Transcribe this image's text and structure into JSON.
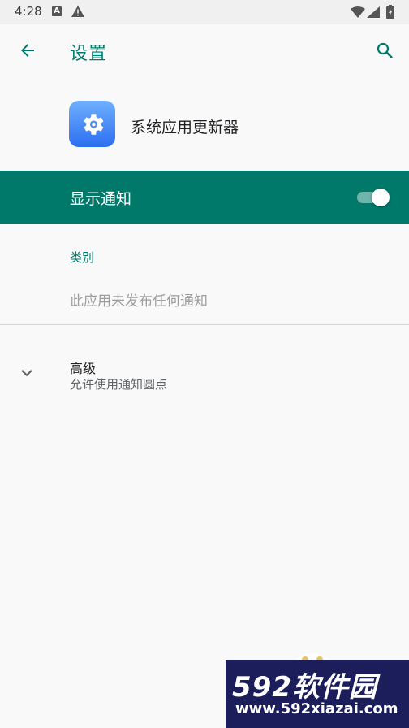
{
  "status_bar": {
    "time": "4:28"
  },
  "app_bar": {
    "title": "设置"
  },
  "app": {
    "name": "系统应用更新器"
  },
  "notifications": {
    "toggle_label": "显示通知",
    "enabled": true
  },
  "category": {
    "header": "类别",
    "empty_text": "此应用未发布任何通知"
  },
  "advanced": {
    "title": "高级",
    "summary": "允许使用通知圆点"
  },
  "watermark": {
    "brand": "592软件园",
    "url": "www.592xiazai.com"
  },
  "colors": {
    "accent": "#00796b",
    "background": "#f9f9f9"
  },
  "icons": [
    "back-arrow-icon",
    "search-icon",
    "settings-gear-icon",
    "chevron-down-icon"
  ]
}
